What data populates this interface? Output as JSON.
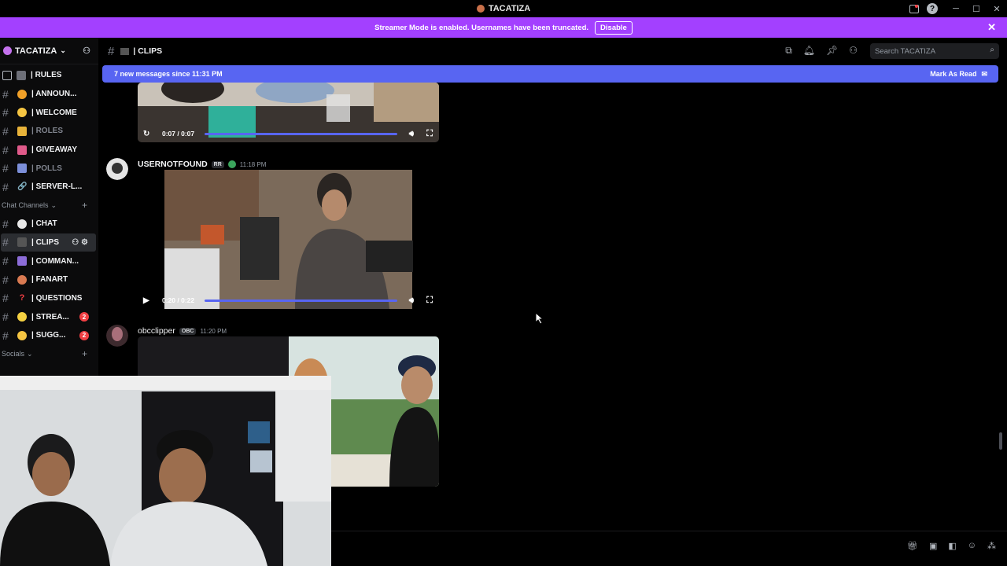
{
  "window": {
    "title": "TACATIZA",
    "controls": [
      "minimize-icon",
      "maximize-icon",
      "close-icon"
    ]
  },
  "streamer_banner": {
    "text": "Streamer Mode is enabled. Usernames have been truncated.",
    "button_label": "Disable"
  },
  "server": {
    "name": "TACATIZA"
  },
  "channels": [
    {
      "name": "| RULES",
      "icon": "rules-icon",
      "muted": false
    },
    {
      "name": "| ANNOUN...",
      "icon": "announce-icon",
      "muted": false
    },
    {
      "name": "| WELCOME",
      "icon": "wave-icon",
      "muted": false
    },
    {
      "name": "| ROLES",
      "icon": "folder-icon",
      "muted": true
    },
    {
      "name": "| GIVEAWAY",
      "icon": "party-icon",
      "muted": false
    },
    {
      "name": "| POLLS",
      "icon": "chart-icon",
      "muted": true
    },
    {
      "name": "| SERVER-L...",
      "icon": "link-icon",
      "muted": false
    }
  ],
  "chat_category": {
    "label": "Chat Channels"
  },
  "chat_channels": [
    {
      "name": "| CHAT",
      "icon": "speech-icon"
    },
    {
      "name": "| CLIPS",
      "icon": "clapper-icon",
      "active": true
    },
    {
      "name": "| COMMAN...",
      "icon": "bot-icon"
    },
    {
      "name": "| FANART",
      "icon": "palette-icon"
    },
    {
      "name": "| QUESTIONS",
      "icon": "question-icon"
    },
    {
      "name": "| STREA...",
      "icon": "bulb-icon",
      "badge": "2"
    },
    {
      "name": "| SUGG...",
      "icon": "thinking-icon",
      "badge": "2"
    }
  ],
  "socials_category": {
    "label": "Socials"
  },
  "channel_header": {
    "title": "| CLIPS",
    "search_placeholder": "Search TACATIZA"
  },
  "new_messages": {
    "text": "7 new messages since 11:31 PM",
    "mark_read": "Mark As Read"
  },
  "messages": [
    {
      "video": {
        "time": "0:07 / 0:07",
        "progress": 1.0
      }
    },
    {
      "username": "USERNOTFOUND",
      "tag": "RR",
      "timestamp": "11:18 PM",
      "video": {
        "time": "0:20 / 0:22",
        "progress": 0.95
      }
    },
    {
      "username": "obcclipper",
      "tag": "OBC",
      "timestamp": "11:20 PM"
    }
  ],
  "colors": {
    "banner": "#a340ff",
    "accent": "#5865f2",
    "badge": "#f23f43"
  }
}
